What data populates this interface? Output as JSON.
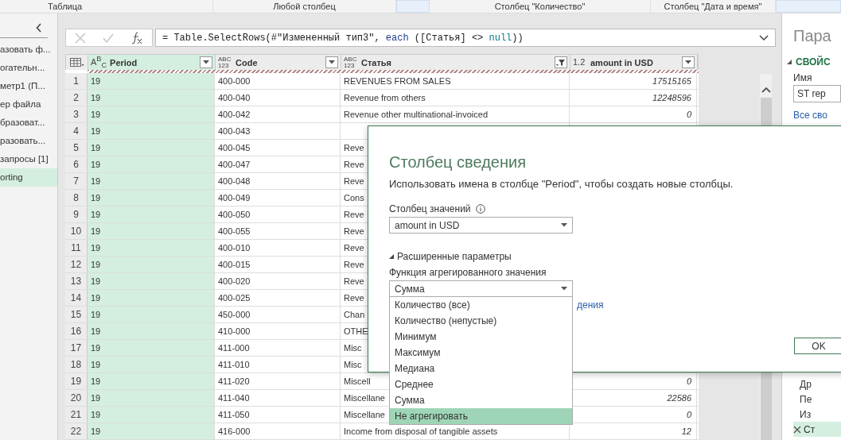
{
  "ribbon": {
    "groups": [
      {
        "label": "Таблица",
        "kind": "text"
      },
      {
        "label": "Любой столбец",
        "kind": "text"
      },
      {
        "kind": "blank"
      },
      {
        "label": "Столбец \"Количество\"",
        "kind": "text"
      },
      {
        "label": "Столбец \"Дата и время\"",
        "kind": "text"
      },
      {
        "kind": "blank"
      }
    ]
  },
  "queries": {
    "items": [
      {
        "label": "азовать ф...",
        "selected": false
      },
      {
        "label": "огательн...",
        "selected": false
      },
      {
        "label": "метр1 (П...",
        "selected": false
      },
      {
        "label": "ер файла",
        "selected": false
      },
      {
        "label": "бразоват...",
        "selected": false
      },
      {
        "label": "разовать...",
        "selected": false
      },
      {
        "label": "запросы [1]",
        "selected": false
      },
      {
        "label": "orting",
        "selected": true
      }
    ]
  },
  "formula_bar": {
    "parts": [
      {
        "text": "= Table.SelectRows(#\"Измененный тип3\", ",
        "kind": "plain"
      },
      {
        "text": "each",
        "kind": "keyword"
      },
      {
        "text": " ([Статья] <> ",
        "kind": "plain"
      },
      {
        "text": "null",
        "kind": "literal"
      },
      {
        "text": "))",
        "kind": "plain"
      }
    ]
  },
  "table": {
    "columns": [
      {
        "name": "Period",
        "type": [
          "A$^{B}$$_{C}$"
        ],
        "selected": true,
        "filtered": false
      },
      {
        "name": "Code",
        "type": [
          "ABC",
          "123"
        ],
        "selected": false,
        "filtered": false
      },
      {
        "name": "Статья",
        "type": [
          "ABC",
          "123"
        ],
        "selected": false,
        "filtered": true
      },
      {
        "name": "amount in USD",
        "type": [
          "1.2"
        ],
        "selected": false,
        "filtered": false
      }
    ],
    "rows": [
      {
        "n": "1",
        "cells": [
          "19",
          "400-000",
          "REVENUES FROM SALES",
          "17515165"
        ]
      },
      {
        "n": "2",
        "cells": [
          "19",
          "400-040",
          "Revenue from others",
          "12248596"
        ]
      },
      {
        "n": "3",
        "cells": [
          "19",
          "400-042",
          "Revenue other multinational-invoiced",
          "0"
        ]
      },
      {
        "n": "4",
        "cells": [
          "19",
          "400-043"
        ]
      },
      {
        "n": "5",
        "cells": [
          "19",
          "400-045",
          "Reve"
        ]
      },
      {
        "n": "6",
        "cells": [
          "19",
          "400-047",
          "Reve"
        ]
      },
      {
        "n": "7",
        "cells": [
          "19",
          "400-048",
          "Reve"
        ]
      },
      {
        "n": "8",
        "cells": [
          "19",
          "400-049",
          "Cons"
        ]
      },
      {
        "n": "9",
        "cells": [
          "19",
          "400-050",
          "Reve"
        ]
      },
      {
        "n": "10",
        "cells": [
          "19",
          "400-055",
          "Reve"
        ]
      },
      {
        "n": "11",
        "cells": [
          "19",
          "400-010",
          "Reve"
        ]
      },
      {
        "n": "12",
        "cells": [
          "19",
          "400-015",
          "Reve"
        ]
      },
      {
        "n": "13",
        "cells": [
          "19",
          "400-020",
          "Reve"
        ]
      },
      {
        "n": "14",
        "cells": [
          "19",
          "400-025",
          "Reve"
        ]
      },
      {
        "n": "15",
        "cells": [
          "19",
          "450-000",
          "Chan"
        ]
      },
      {
        "n": "16",
        "cells": [
          "19",
          "410-000",
          "OTHE"
        ]
      },
      {
        "n": "17",
        "cells": [
          "19",
          "411-000",
          "Misc"
        ]
      },
      {
        "n": "18",
        "cells": [
          "19",
          "411-010",
          "Misc"
        ]
      },
      {
        "n": "19",
        "cells": [
          "19",
          "411-020",
          "Miscell",
          "0"
        ]
      },
      {
        "n": "20",
        "cells": [
          "19",
          "411-040",
          "Miscellane",
          "22586"
        ]
      },
      {
        "n": "21",
        "cells": [
          "19",
          "411-050",
          "Miscellane",
          "0"
        ]
      },
      {
        "n": "22",
        "cells": [
          "19",
          "416-000",
          "Income from disposal of tangible assets",
          "12"
        ]
      }
    ]
  },
  "query_settings": {
    "title": "Пара",
    "section": "СВОЙС",
    "name_label": "Имя",
    "name_value": "ST rep",
    "all_properties_link": "Все сво",
    "steps": [
      {
        "label": "Др",
        "selected": false
      },
      {
        "label": "Пе",
        "selected": false
      },
      {
        "label": "Из",
        "selected": false
      },
      {
        "label": "Ст",
        "selected": true
      }
    ]
  },
  "dialog": {
    "title": "Столбец сведения",
    "description": "Использовать имена в столбце \"Period\", чтобы создать новые столбцы.",
    "values_label": "Столбец значений",
    "values_select": "amount in USD",
    "advanced": {
      "label": "Расширенные параметры",
      "expanded": true
    },
    "aggregate_label": "Функция агрегированного значения",
    "aggregate_select": "Сумма",
    "link": "дения",
    "ok": "OK",
    "options": [
      {
        "label": "Количество (все)",
        "selected": false
      },
      {
        "label": "Количество (непустые)",
        "selected": false
      },
      {
        "label": "Минимум",
        "selected": false
      },
      {
        "label": "Максимум",
        "selected": false
      },
      {
        "label": "Медиана",
        "selected": false
      },
      {
        "label": "Среднее",
        "selected": false
      },
      {
        "label": "Сумма",
        "selected": false
      },
      {
        "label": "Не агрегировать",
        "selected": true
      }
    ]
  }
}
